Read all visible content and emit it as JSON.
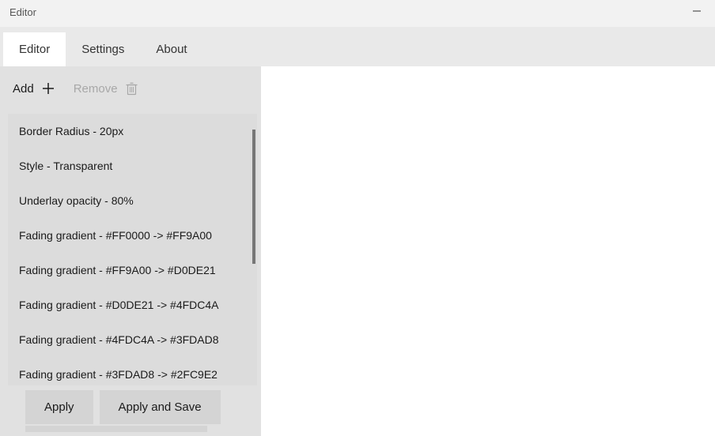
{
  "window": {
    "title": "Editor"
  },
  "tabs": [
    {
      "label": "Editor",
      "active": true
    },
    {
      "label": "Settings",
      "active": false
    },
    {
      "label": "About",
      "active": false
    }
  ],
  "toolbar": {
    "add_label": "Add",
    "remove_label": "Remove"
  },
  "list_items": [
    {
      "label": "Border Radius - 20px"
    },
    {
      "label": "Style - Transparent"
    },
    {
      "label": "Underlay opacity - 80%"
    },
    {
      "label": "Fading gradient - #FF0000 -> #FF9A00"
    },
    {
      "label": "Fading gradient - #FF9A00 -> #D0DE21"
    },
    {
      "label": "Fading gradient - #D0DE21 -> #4FDC4A"
    },
    {
      "label": "Fading gradient - #4FDC4A -> #3FDAD8"
    },
    {
      "label": "Fading gradient - #3FDAD8 -> #2FC9E2"
    }
  ],
  "buttons": {
    "apply": "Apply",
    "apply_save": "Apply and Save"
  }
}
